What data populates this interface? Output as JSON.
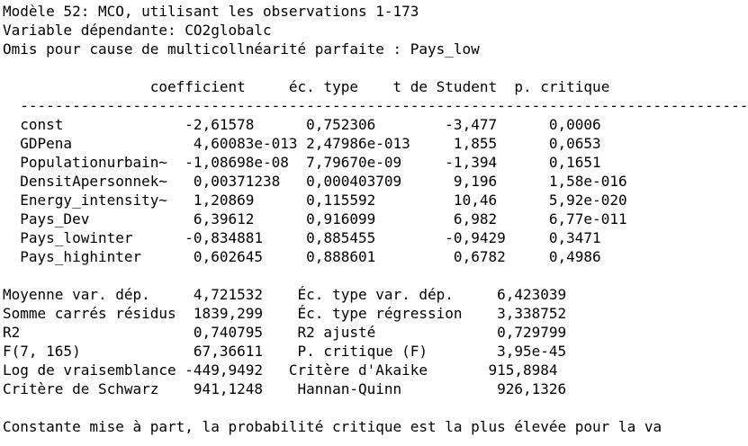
{
  "model": {
    "title": "Modèle 52: MCO, utilisant les observations 1-173",
    "dependent": "Variable dépendante: CO2globalc",
    "omitted": "Omis pour cause de multicollnéarité parfaite : Pays_low"
  },
  "table": {
    "headers": [
      "coefficient",
      "éc. type",
      "t de Student",
      "p. critique"
    ],
    "separator": "  --------------------------------------------------------------------------------------------------",
    "rows": [
      {
        "name": "const",
        "coef": "-2,61578",
        "se": "0,752306",
        "t": "-3,477",
        "p": "0,0006"
      },
      {
        "name": "GDPena",
        "coef": "4,60083e-013",
        "se": "2,47986e-013",
        "t": "1,855",
        "p": "0,0653"
      },
      {
        "name": "Populationurbain~",
        "coef": "-1,08698e-08",
        "se": "7,79670e-09",
        "t": "-1,394",
        "p": "0,1651"
      },
      {
        "name": "DensitApersonnek~",
        "coef": "0,00371238",
        "se": "0,000403709",
        "t": "9,196",
        "p": "1,58e-016"
      },
      {
        "name": "Energy_intensity~",
        "coef": "1,20869",
        "se": "0,115592",
        "t": "10,46",
        "p": "5,92e-020"
      },
      {
        "name": "Pays_Dev",
        "coef": "6,39612",
        "se": "0,916099",
        "t": "6,982",
        "p": "6,77e-011"
      },
      {
        "name": "Pays_lowinter",
        "coef": "-0,834881",
        "se": "0,885455",
        "t": "-0,9429",
        "p": "0,3471"
      },
      {
        "name": "Pays_highinter",
        "coef": "0,602645",
        "se": "0,888601",
        "t": "0,6782",
        "p": "0,4986"
      }
    ]
  },
  "stats": [
    {
      "l1": "Moyenne var. dép.",
      "v1": "4,721532",
      "l2": "Éc. type var. dép.",
      "v2": "6,423039"
    },
    {
      "l1": "Somme carrés résidus",
      "v1": "1839,299",
      "l2": "Éc. type régression",
      "v2": "3,338752"
    },
    {
      "l1": "R2",
      "v1": "0,740795",
      "l2": "R2 ajusté",
      "v2": "0,729799"
    },
    {
      "l1": "F(7, 165)",
      "v1": "67,36611",
      "l2": "P. critique (F)",
      "v2": "3,95e-45"
    },
    {
      "l1": "Log de vraisemblance",
      "v1": "-449,9492",
      "l2": "Critère d'Akaike",
      "v2": "915,8984"
    },
    {
      "l1": "Critère de Schwarz",
      "v1": "941,1248",
      "l2": "Hannan-Quinn",
      "v2": "926,1326"
    }
  ],
  "footer": "Constante mise à part, la probabilité critique est la plus élevée pour la va"
}
